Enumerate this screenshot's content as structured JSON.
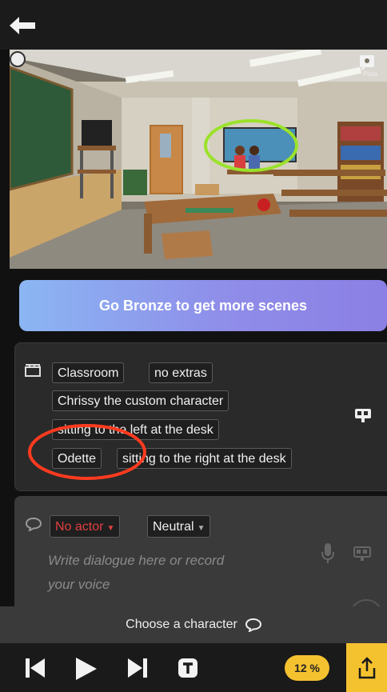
{
  "topbar": {
    "back_icon": "arrow-left-icon"
  },
  "scene": {
    "badge_label": "Plota"
  },
  "upgrade": {
    "label": "Go Bronze to get more scenes"
  },
  "scene_panel": {
    "location": "Classroom",
    "extras": "no extras",
    "character_1": "Chrissy the custom character",
    "character_1_position": "sitting to the left at the desk",
    "character_2": "Odette",
    "character_2_position": "sitting to the right at the desk"
  },
  "dialogue_panel": {
    "actor": "No actor",
    "emotion": "Neutral",
    "placeholder_line1": "Write dialogue here or record",
    "placeholder_line2": "your voice"
  },
  "chooser": {
    "label": "Choose a character"
  },
  "bottombar": {
    "progress_label": "12 %"
  },
  "colors": {
    "accent_yellow": "#f5c22f",
    "actor_red": "#e04040",
    "annotation_green": "#9be22a",
    "annotation_red": "#ff3b1f"
  }
}
